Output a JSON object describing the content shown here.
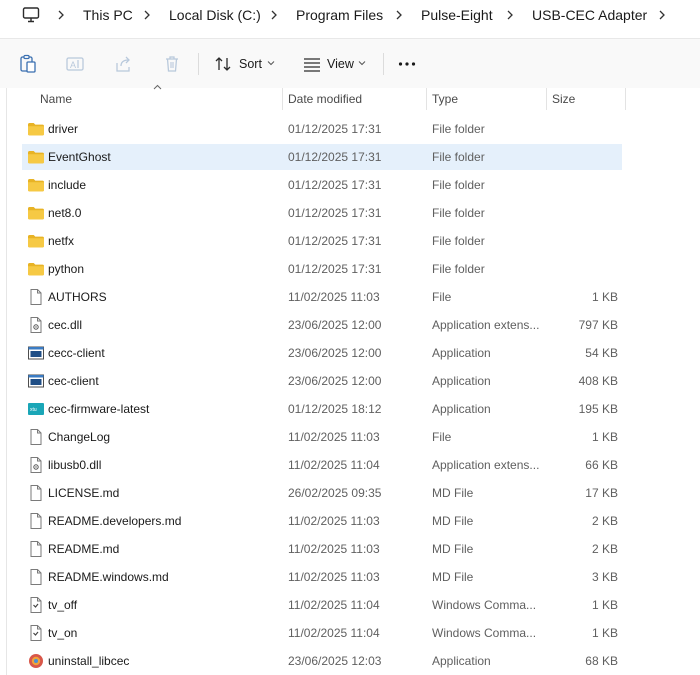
{
  "breadcrumb": {
    "items": [
      "This PC",
      "Local Disk (C:)",
      "Program Files",
      "Pulse-Eight",
      "USB-CEC Adapter"
    ]
  },
  "toolbar": {
    "sort_label": "Sort",
    "view_label": "View",
    "more_label": "···"
  },
  "columns": {
    "name": "Name",
    "date": "Date modified",
    "type": "Type",
    "size": "Size"
  },
  "files": [
    {
      "name": "driver",
      "date": "01/12/2025 17:31",
      "type": "File folder",
      "size": "",
      "icon": "folder-icon"
    },
    {
      "name": "EventGhost",
      "date": "01/12/2025 17:31",
      "type": "File folder",
      "size": "",
      "icon": "folder-icon"
    },
    {
      "name": "include",
      "date": "01/12/2025 17:31",
      "type": "File folder",
      "size": "",
      "icon": "folder-icon"
    },
    {
      "name": "net8.0",
      "date": "01/12/2025 17:31",
      "type": "File folder",
      "size": "",
      "icon": "folder-icon"
    },
    {
      "name": "netfx",
      "date": "01/12/2025 17:31",
      "type": "File folder",
      "size": "",
      "icon": "folder-icon"
    },
    {
      "name": "python",
      "date": "01/12/2025 17:31",
      "type": "File folder",
      "size": "",
      "icon": "folder-icon"
    },
    {
      "name": "AUTHORS",
      "date": "11/02/2025 11:03",
      "type": "File",
      "size": "1 KB",
      "icon": "file-icon"
    },
    {
      "name": "cec.dll",
      "date": "23/06/2025 12:00",
      "type": "Application extens...",
      "size": "797 KB",
      "icon": "dll-file-icon"
    },
    {
      "name": "cecc-client",
      "date": "23/06/2025 12:00",
      "type": "Application",
      "size": "54 KB",
      "icon": "application-icon"
    },
    {
      "name": "cec-client",
      "date": "23/06/2025 12:00",
      "type": "Application",
      "size": "408 KB",
      "icon": "application-icon"
    },
    {
      "name": "cec-firmware-latest",
      "date": "01/12/2025 18:12",
      "type": "Application",
      "size": "195 KB",
      "icon": "firmware-app-icon"
    },
    {
      "name": "ChangeLog",
      "date": "11/02/2025 11:03",
      "type": "File",
      "size": "1 KB",
      "icon": "file-icon"
    },
    {
      "name": "libusb0.dll",
      "date": "11/02/2025 11:04",
      "type": "Application extens...",
      "size": "66 KB",
      "icon": "dll-file-icon"
    },
    {
      "name": "LICENSE.md",
      "date": "26/02/2025 09:35",
      "type": "MD File",
      "size": "17 KB",
      "icon": "file-icon"
    },
    {
      "name": "README.developers.md",
      "date": "11/02/2025 11:03",
      "type": "MD File",
      "size": "2 KB",
      "icon": "file-icon"
    },
    {
      "name": "README.md",
      "date": "11/02/2025 11:03",
      "type": "MD File",
      "size": "2 KB",
      "icon": "file-icon"
    },
    {
      "name": "README.windows.md",
      "date": "11/02/2025 11:03",
      "type": "MD File",
      "size": "3 KB",
      "icon": "file-icon"
    },
    {
      "name": "tv_off",
      "date": "11/02/2025 11:04",
      "type": "Windows Comma...",
      "size": "1 KB",
      "icon": "script-file-icon"
    },
    {
      "name": "tv_on",
      "date": "11/02/2025 11:04",
      "type": "Windows Comma...",
      "size": "1 KB",
      "icon": "script-file-icon"
    },
    {
      "name": "uninstall_libcec",
      "date": "23/06/2025 12:03",
      "type": "Application",
      "size": "68 KB",
      "icon": "installer-icon"
    }
  ],
  "selected_index": 1,
  "colors": {
    "selection": "#e5f0fb",
    "folder": "#f4c63b"
  }
}
